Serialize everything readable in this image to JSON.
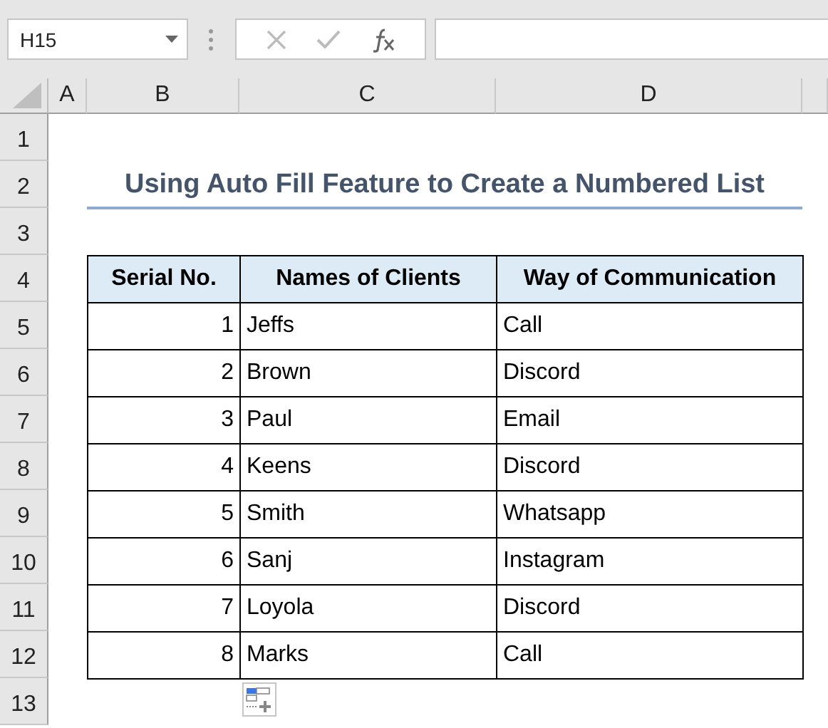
{
  "name_box": {
    "value": "H15"
  },
  "column_headers": [
    "A",
    "B",
    "C",
    "D"
  ],
  "row_headers": [
    "1",
    "2",
    "3",
    "4",
    "5",
    "6",
    "7",
    "8",
    "9",
    "10",
    "11",
    "12",
    "13"
  ],
  "title": "Using Auto Fill Feature to Create a Numbered List",
  "table": {
    "columns": [
      "Serial No.",
      "Names of Clients",
      "Way of Communication"
    ],
    "rows": [
      [
        "1",
        "Jeffs",
        "Call"
      ],
      [
        "2",
        "Brown",
        "Discord"
      ],
      [
        "3",
        "Paul",
        "Email"
      ],
      [
        "4",
        "Keens",
        "Discord"
      ],
      [
        "5",
        "Smith",
        "Whatsapp"
      ],
      [
        "6",
        "Sanj",
        "Instagram"
      ],
      [
        "7",
        "Loyola",
        "Discord"
      ],
      [
        "8",
        "Marks",
        "Call"
      ]
    ]
  }
}
